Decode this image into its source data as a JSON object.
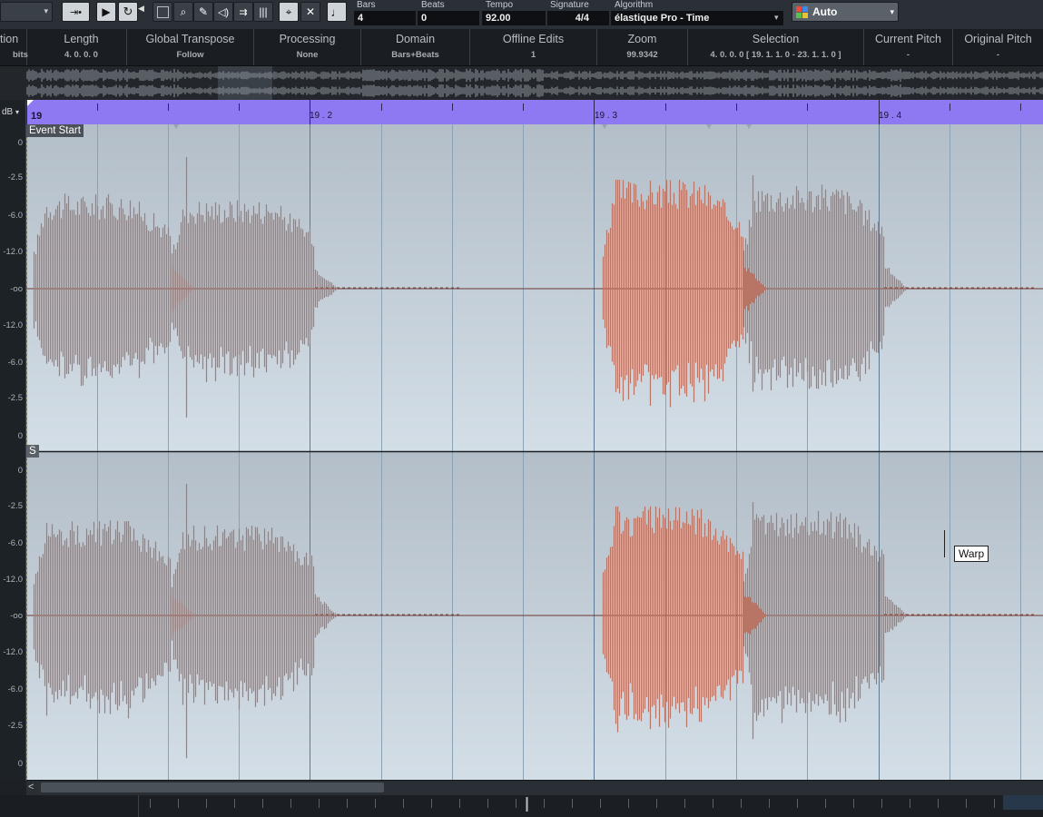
{
  "toolbar": {
    "play_icon": "play-icon",
    "cycle_icon": "cycle-icon",
    "musical_mode_icon": "note-icon",
    "auto_label": "Auto",
    "fields": {
      "bars": {
        "label": "Bars",
        "value": "4"
      },
      "beats": {
        "label": "Beats",
        "value": "0"
      },
      "tempo": {
        "label": "Tempo",
        "value": "92.00"
      },
      "signature": {
        "label": "Signature",
        "value": "4/4"
      },
      "algorithm": {
        "label": "Algorithm",
        "value": "élastique Pro - Time"
      }
    }
  },
  "infoline": {
    "columns": [
      {
        "header": "tion",
        "value": "bits"
      },
      {
        "header": "Length",
        "value": "4. 0. 0.  0"
      },
      {
        "header": "Global Transpose",
        "value": "Follow"
      },
      {
        "header": "Processing",
        "value": "None"
      },
      {
        "header": "Domain",
        "value": "Bars+Beats"
      },
      {
        "header": "Offline Edits",
        "value": "1"
      },
      {
        "header": "Zoom",
        "value": "99.9342"
      },
      {
        "header": "Selection",
        "value": "4. 0. 0.  0 [ 19. 1. 1.  0 - 23. 1. 1.  0 ]"
      },
      {
        "header": "Current Pitch",
        "value": "-"
      },
      {
        "header": "Original Pitch",
        "value": "-"
      }
    ]
  },
  "ruler": {
    "unit_label": "dB",
    "bar_start": "19",
    "labels": [
      "19 . 2",
      "19 . 3",
      "19 . 4"
    ]
  },
  "event_start_label": "Event Start",
  "snap_label": "S",
  "db_ticks": [
    "0",
    "-2.5",
    "-6.0",
    "-12.0",
    "-oo",
    "-12.0",
    "-6.0",
    "-2.5",
    "0"
  ],
  "warp_tooltip": "Warp",
  "colors": {
    "ruler": "#8f79f2",
    "waveform": "#b87464",
    "waveform_line": "#6a3b32",
    "background_top": "#b5c0ca",
    "background_bottom": "#d2dde6"
  }
}
